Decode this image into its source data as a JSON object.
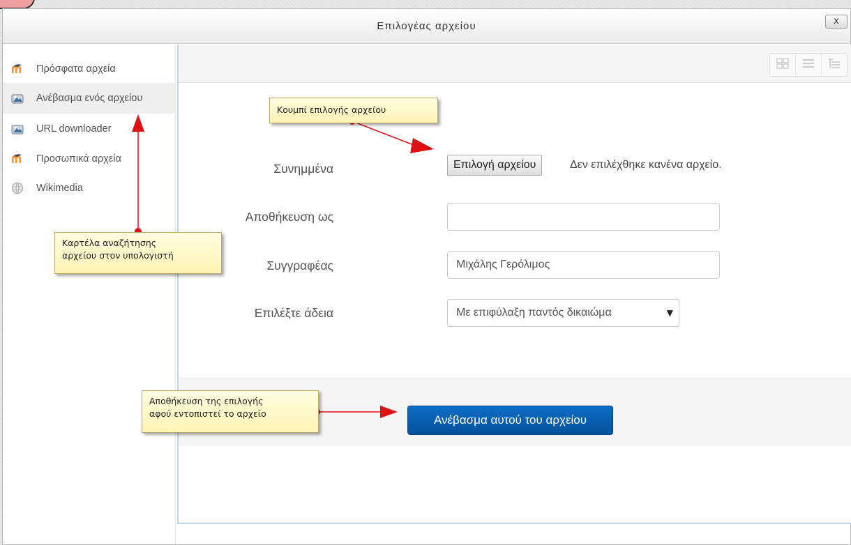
{
  "dialog": {
    "title": "Επιλογέας αρχείου",
    "close_label": "x"
  },
  "sidebar": {
    "items": [
      {
        "label": "Πρόσφατα αρχεία",
        "icon": "moodle-icon"
      },
      {
        "label": "Ανέβασμα ενός αρχείου",
        "icon": "upload-icon",
        "active": true
      },
      {
        "label": "URL downloader",
        "icon": "url-download-icon"
      },
      {
        "label": "Προσωπικά αρχεία",
        "icon": "moodle-icon"
      },
      {
        "label": "Wikimedia",
        "icon": "wikimedia-icon"
      }
    ]
  },
  "toolbar": {
    "views": [
      "icon-view-icon",
      "list-view-icon",
      "tree-view-icon"
    ]
  },
  "form": {
    "attachment_label": "Συνημμένα",
    "file_button_label": "Επιλογή αρχείου",
    "no_file_text": "Δεν επιλέχθηκε κανένα αρχείο.",
    "save_as_label": "Αποθήκευση ως",
    "save_as_value": "",
    "author_label": "Συγγραφέας",
    "author_value": "Μιχάλης Γερόλιμος",
    "license_label": "Επιλέξτε άδεια",
    "license_value": "Με επιφύλαξη παντός δικαιώμα",
    "upload_button_label": "Ανέβασμα αυτού του αρχείου"
  },
  "callouts": {
    "file_button_note": "Κουμπί επιλογής αρχείου",
    "tab_note_line1": "Καρτέλα αναζήτησης",
    "tab_note_line2": "αρχείου στον υπολογιστή",
    "save_note_line1": "Αποθήκευση της επιλογής",
    "save_note_line2": "αφού εντοπιστεί το αρχείο"
  },
  "colors": {
    "primary_button": "#0b6dc6",
    "arrow": "#dd1111",
    "callout_bg": "#fff6c0"
  }
}
